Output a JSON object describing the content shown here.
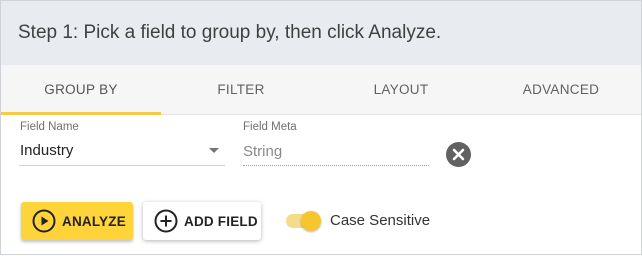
{
  "header": {
    "title": "Step 1: Pick a field to group by, then click Analyze."
  },
  "tabs": [
    {
      "label": "GROUP BY",
      "active": true
    },
    {
      "label": "FILTER",
      "active": false
    },
    {
      "label": "LAYOUT",
      "active": false
    },
    {
      "label": "ADVANCED",
      "active": false
    }
  ],
  "fields": {
    "field_name": {
      "label": "Field Name",
      "value": "Industry"
    },
    "field_meta": {
      "label": "Field Meta",
      "value": "String"
    }
  },
  "actions": {
    "analyze_label": "ANALYZE",
    "add_field_label": "ADD FIELD",
    "case_sensitive": {
      "label": "Case Sensitive",
      "on": true
    }
  },
  "icons": {
    "analyze": "play-circle-icon",
    "add_field": "plus-circle-icon",
    "clear": "close-circle-icon",
    "dropdown": "caret-down-icon"
  },
  "colors": {
    "accent": "#ffd43b",
    "tab_indicator": "#f7c948",
    "header_bg": "#e8ecf0",
    "tabs_bg": "#f6f6f6"
  }
}
